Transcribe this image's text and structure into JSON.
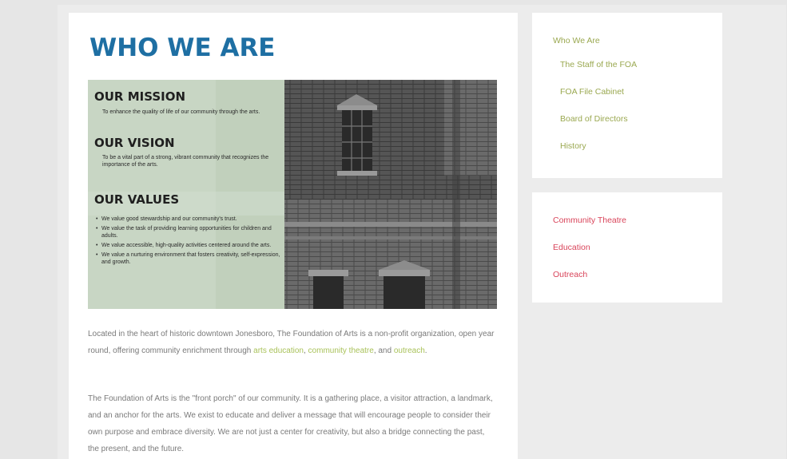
{
  "main": {
    "title": "WHO WE ARE",
    "hero": {
      "mission_heading": "OUR MISSION",
      "mission_text": "To enhance the quality of life of our community through the arts.",
      "vision_heading": "OUR VISION",
      "vision_text": "To be a vital part of a strong, vibrant community that recognizes the importance of the arts.",
      "values_heading": "OUR VALUES",
      "values": [
        "We value good stewardship and our community's trust.",
        "We value the task of providing learning opportunities for children and adults.",
        "We value accessible, high-quality activities centered around the arts.",
        "We value a nurturing environment that fosters creativity, self-expression, and growth."
      ]
    },
    "paragraph1": {
      "text_before": "Located in the heart of historic downtown Jonesboro, The Foundation of Arts is a non-profit organization, open year round, offering community enrichment through ",
      "link1": "arts education",
      "sep1": ", ",
      "link2": "community theatre",
      "sep2": ", and ",
      "link3": "outreach",
      "text_after": "."
    },
    "paragraph2": "The Foundation of Arts is the \"front porch\" of our community. It is a gathering place, a visitor attraction, a landmark, and an anchor for the arts. We exist to educate and deliver a message that will encourage people to consider their own purpose and embrace diversity. We are not just a center for creativity, but also a bridge connecting the past, the present, and the future."
  },
  "sidebar_top": {
    "heading": "Who We Are",
    "items": [
      "The Staff of the FOA",
      "FOA File Cabinet",
      "Board of Directors",
      "History"
    ]
  },
  "sidebar_bottom": {
    "items": [
      "Community Theatre",
      "Education",
      "Outreach"
    ]
  },
  "colors": {
    "title": "#1e6fa3",
    "link_green": "#a9c25a",
    "sidebar_green": "#9aa850",
    "sidebar_red": "#d9445a",
    "body_text": "#7a7a7a"
  }
}
